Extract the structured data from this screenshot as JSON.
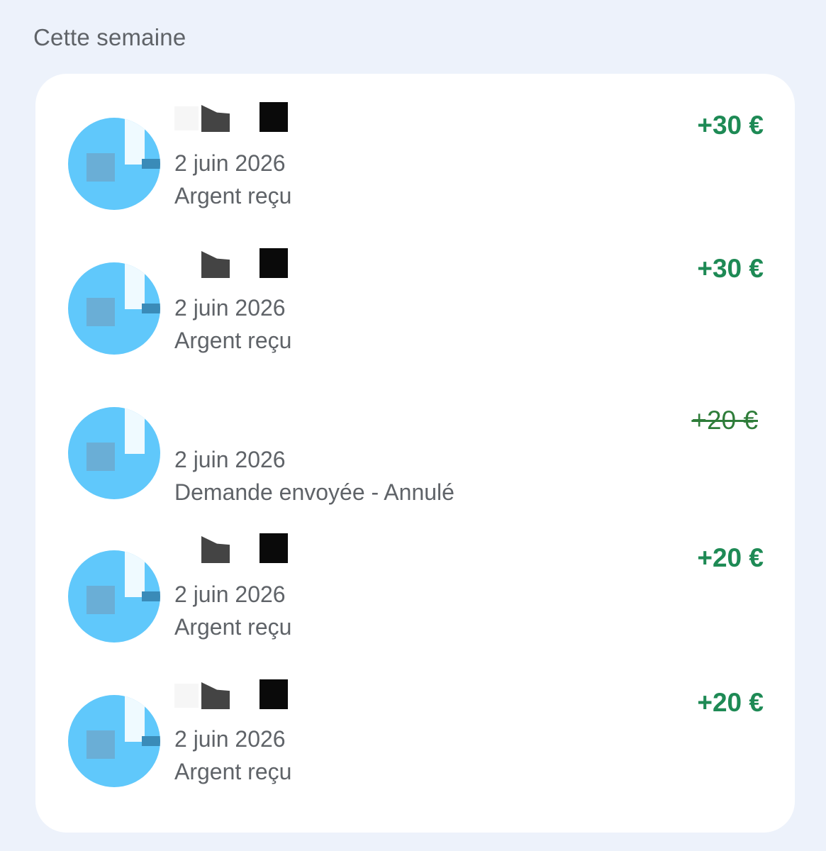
{
  "section": {
    "title": "Cette semaine"
  },
  "colors": {
    "positive": "#1e8a55",
    "canceled": "#2f7d3a",
    "muted_text": "#5f6368",
    "avatar": "#60c8fb"
  },
  "transactions": [
    {
      "amount": "+30 €",
      "date": "2 juin 2026",
      "description": "Argent reçu",
      "status": "completed",
      "avatar_icon": "avatar-icon"
    },
    {
      "amount": "+30 €",
      "date": "2 juin 2026",
      "description": "Argent reçu",
      "status": "completed",
      "avatar_icon": "avatar-icon"
    },
    {
      "amount": "+20 €",
      "date": "2 juin 2026",
      "description": "Demande envoyée - Annulé",
      "status": "canceled",
      "avatar_icon": "avatar-icon"
    },
    {
      "amount": "+20 €",
      "date": "2 juin 2026",
      "description": "Argent reçu",
      "status": "completed",
      "avatar_icon": "avatar-icon"
    },
    {
      "amount": "+20 €",
      "date": "2 juin 2026",
      "description": "Argent reçu",
      "status": "completed",
      "avatar_icon": "avatar-icon"
    }
  ]
}
